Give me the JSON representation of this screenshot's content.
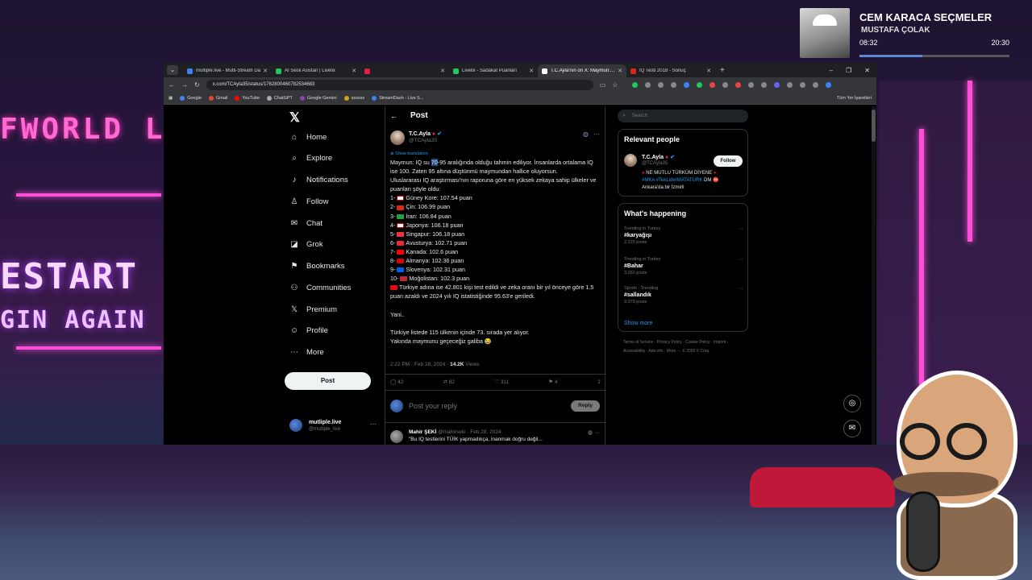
{
  "music": {
    "title": "CEM KARACA SEÇMELER",
    "artist": "MUSTAFA ÇOLAK",
    "current_time": "08:32",
    "total_time": "20:30",
    "progress": 0.42
  },
  "browser": {
    "tabs": [
      {
        "label": "multiple.live - Multi-Stream Da",
        "color": "#3b82f6"
      },
      {
        "label": "AI Sesli Asistan | Livelix",
        "color": "#22c55e"
      },
      {
        "label": "",
        "color": "#e11d48"
      },
      {
        "label": "Livelix - Sadakat Puanları",
        "color": "#22c55e"
      },
      {
        "label": "T.C.Ayla'nın on X: Maymun: IQ s",
        "color": "#ffffff",
        "active": true
      },
      {
        "label": "IQ Testi 2018 - Sonuç",
        "color": "#dc2626"
      }
    ],
    "url": "x.com/TCAyla35/status/1762800460782534683",
    "bookmarks": [
      "Google",
      "Gmail",
      "YouTube",
      "ChatGPT",
      "Google Gemini",
      "ssssss",
      "StreamDash - Live S..."
    ],
    "bookmarks_right": "Tüm Yer İşaretleri"
  },
  "nav": {
    "logo": "𝕏",
    "items": [
      {
        "label": "Home",
        "icon": "⌂"
      },
      {
        "label": "Explore",
        "icon": "⌕"
      },
      {
        "label": "Notifications",
        "icon": "♪"
      },
      {
        "label": "Follow",
        "icon": "♙"
      },
      {
        "label": "Chat",
        "icon": "✉"
      },
      {
        "label": "Grok",
        "icon": "◪"
      },
      {
        "label": "Bookmarks",
        "icon": "⚑"
      },
      {
        "label": "Communities",
        "icon": "⚇"
      },
      {
        "label": "Premium",
        "icon": "𝕏"
      },
      {
        "label": "Profile",
        "icon": "☺"
      },
      {
        "label": "More",
        "icon": "⋯"
      }
    ],
    "post_button": "Post",
    "account_name": "mutliple.live",
    "account_handle": "@mutliple_live"
  },
  "post": {
    "header": "Post",
    "author_name": "T.C.Ayla",
    "author_handle": "@TCAyla35",
    "show_translation": "Show translation",
    "intro_a": "Maymun: IQ su ",
    "intro_hl": "70",
    "intro_b": "-95 aralığında olduğu tahmin ediliyor. İnsanlarda ortalama IQ ise 100. Zaten 95 altına düştünmü maymundan hallice oluyorsun.",
    "para2": "Uluslararası IQ araştırması'nın raporuna göre en yüksek zekaya sahip ülkeler ve puanları şöyle oldu:",
    "rankings": [
      {
        "rank": "1-",
        "text": "Güney Kore: 107.54 puan",
        "flag": "#ffffff"
      },
      {
        "rank": "2-",
        "text": "Çin: 106.99 puan",
        "flag": "#de2910"
      },
      {
        "rank": "3-",
        "text": "İran: 106.84 puan",
        "flag": "#239f40"
      },
      {
        "rank": "4-",
        "text": "Japonya: 106.18 puan",
        "flag": "#ffffff"
      },
      {
        "rank": "5-",
        "text": "Singapur: 106.18 puan",
        "flag": "#ef3340"
      },
      {
        "rank": "6-",
        "text": "Avusturya: 102.71 puan",
        "flag": "#ed2939"
      },
      {
        "rank": "7-",
        "text": "Kanada: 102.6 puan",
        "flag": "#ff0000"
      },
      {
        "rank": "8-",
        "text": "Almanya: 102.36 puan",
        "flag": "#dd0000"
      },
      {
        "rank": "9-",
        "text": "Slovenya: 102.31 puan",
        "flag": "#005ce5"
      },
      {
        "rank": "10-",
        "text": "Moğolistan: 102.3 puan",
        "flag": "#c4272f"
      }
    ],
    "turkey_line": "Türkiye adına ise 42.801 kişi test edildi ve zeka oranı bir yıl önceye göre 1.5 puan azaldı ve 2024 yılı IQ istatistiğinde 95.63'e geriledi.",
    "yani": "Yani..",
    "closing1": "Türkiye listede 115 ülkenin içinde 73. sırada yer alıyor.",
    "closing2": "Yakında maymunu geçeceğiz galiba 😂",
    "meta_time": "2:22 PM · Feb 28, 2024 · ",
    "meta_views": "14.2K",
    "meta_views_label": " Views",
    "replies": "42",
    "reposts": "82",
    "likes": "311",
    "bookmarks": "4",
    "reply_placeholder": "Post your reply",
    "reply_button": "Reply",
    "comment_name": "Mahir ŞEKİ",
    "comment_meta": " @mahirseki · Feb 28, 2024",
    "comment_text": "\"Bu IQ testlerini TÜİK yapmadıkça, inanmak doğru değil..."
  },
  "right": {
    "search_placeholder": "Search",
    "relevant_title": "Relevant people",
    "rp_name": "T.C.Ayla",
    "rp_handle": "@TCAyla35",
    "follow": "Follow",
    "rp_bio1": "NE MUTLU TÜRKÜM DİYENE",
    "rp_bio_tags": "#MKA #TekLiderMATATÜRK",
    "rp_bio_dm": " DM",
    "rp_bio2": "Ankara'da bir İzmirli",
    "happening_title": "What's happening",
    "trends": [
      {
        "context": "Trending in Turkey",
        "name": "#karyağışı",
        "posts": "2,225 posts"
      },
      {
        "context": "Trending in Turkey",
        "name": "#Bahar",
        "posts": "3,262 posts"
      },
      {
        "context": "Sports · Trending",
        "name": "#sallandık",
        "posts": "9,079 posts"
      }
    ],
    "show_more": "Show more",
    "footer": "Terms of Service · Privacy Policy · Cookie Policy · Imprint · Accessibility · Ads info · More ··· © 2025 X Corp."
  },
  "background": {
    "sign1": "FWORLD L",
    "sign2": "ESTART",
    "sign3": "GIN AGAIN"
  }
}
